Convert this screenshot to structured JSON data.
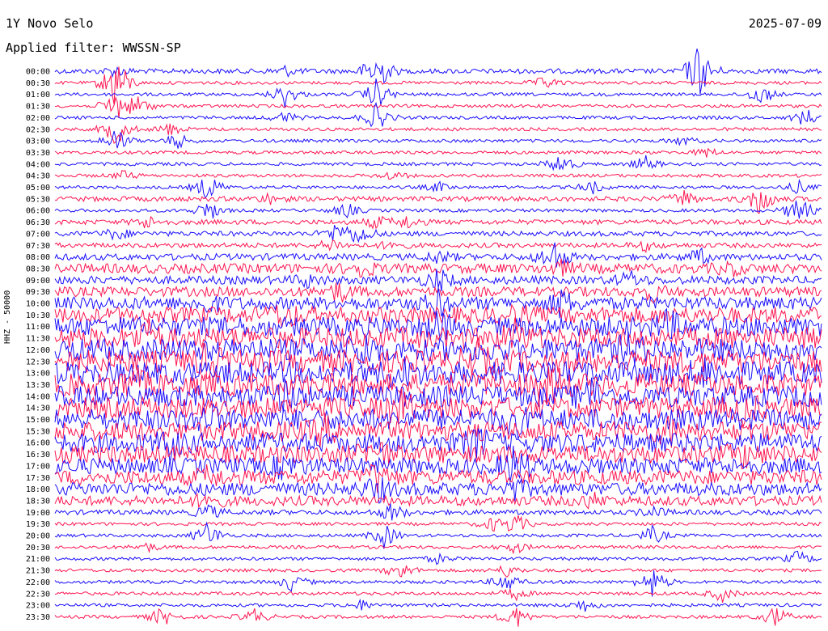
{
  "header": {
    "station": "1Y Novo Selo",
    "date": "2025-07-09",
    "filter": "Applied filter: WWSSN-SP"
  },
  "axis": {
    "ylabel": "HHZ - 50000"
  },
  "colors": {
    "even_trace": "#1a0dff",
    "odd_trace": "#ff1450",
    "background": "#ffffff"
  },
  "chart_data": {
    "type": "line",
    "description_kind": "helicorder",
    "xlabel": "",
    "ylabel": "HHZ - 50000",
    "rows": [
      {
        "time": "00:00",
        "noise": 3,
        "events": [
          [
            0.08,
            6
          ],
          [
            0.42,
            30
          ],
          [
            0.3,
            6
          ],
          [
            0.84,
            36
          ]
        ]
      },
      {
        "time": "00:30",
        "noise": 2,
        "events": [
          [
            0.64,
            8
          ],
          [
            0.08,
            40
          ]
        ]
      },
      {
        "time": "01:00",
        "noise": 2,
        "events": [
          [
            0.3,
            16
          ],
          [
            0.42,
            20
          ],
          [
            0.92,
            14
          ]
        ]
      },
      {
        "time": "01:30",
        "noise": 2,
        "events": [
          [
            0.11,
            12
          ],
          [
            0.08,
            20
          ]
        ]
      },
      {
        "time": "02:00",
        "noise": 2,
        "events": [
          [
            0.3,
            8
          ],
          [
            0.42,
            18
          ],
          [
            0.98,
            12
          ]
        ]
      },
      {
        "time": "02:30",
        "noise": 2,
        "events": [
          [
            0.08,
            22
          ],
          [
            0.15,
            8
          ]
        ]
      },
      {
        "time": "03:00",
        "noise": 2,
        "events": [
          [
            0.08,
            16
          ],
          [
            0.16,
            10
          ],
          [
            0.82,
            6
          ]
        ]
      },
      {
        "time": "03:30",
        "noise": 2,
        "events": [
          [
            0.85,
            6
          ]
        ]
      },
      {
        "time": "04:00",
        "noise": 2,
        "events": [
          [
            0.77,
            10
          ],
          [
            0.66,
            14
          ]
        ]
      },
      {
        "time": "04:30",
        "noise": 2,
        "events": [
          [
            0.09,
            6
          ],
          [
            0.44,
            6
          ]
        ]
      },
      {
        "time": "05:00",
        "noise": 2,
        "events": [
          [
            0.2,
            18
          ],
          [
            0.5,
            6
          ],
          [
            0.7,
            8
          ],
          [
            0.97,
            8
          ]
        ]
      },
      {
        "time": "05:30",
        "noise": 3,
        "events": [
          [
            0.28,
            6
          ],
          [
            0.92,
            22
          ],
          [
            0.82,
            10
          ]
        ]
      },
      {
        "time": "06:00",
        "noise": 2,
        "events": [
          [
            0.2,
            14
          ],
          [
            0.38,
            10
          ],
          [
            0.97,
            20
          ]
        ]
      },
      {
        "time": "06:30",
        "noise": 3,
        "events": [
          [
            0.12,
            8
          ],
          [
            0.42,
            8
          ],
          [
            0.46,
            8
          ]
        ]
      },
      {
        "time": "07:00",
        "noise": 3,
        "events": [
          [
            0.37,
            16
          ],
          [
            0.4,
            12
          ],
          [
            0.08,
            8
          ]
        ]
      },
      {
        "time": "07:30",
        "noise": 3,
        "events": [
          [
            0.36,
            8
          ],
          [
            0.44,
            6
          ],
          [
            0.77,
            6
          ]
        ]
      },
      {
        "time": "08:00",
        "noise": 4,
        "events": [
          [
            0.5,
            8
          ],
          [
            0.84,
            10
          ],
          [
            0.65,
            22
          ]
        ]
      },
      {
        "time": "08:30",
        "noise": 6,
        "events": [
          [
            0.4,
            10
          ],
          [
            0.66,
            8
          ],
          [
            0.88,
            8
          ]
        ]
      },
      {
        "time": "09:00",
        "noise": 5,
        "events": [
          [
            0.5,
            14
          ],
          [
            0.75,
            10
          ],
          [
            0.33,
            8
          ]
        ]
      },
      {
        "time": "09:30",
        "noise": 6,
        "events": [
          [
            0.37,
            12
          ],
          [
            0.78,
            10
          ]
        ]
      },
      {
        "time": "10:00",
        "noise": 8,
        "events": [
          [
            0.5,
            14
          ],
          [
            0.66,
            16
          ],
          [
            0.2,
            10
          ]
        ]
      },
      {
        "time": "10:30",
        "noise": 10,
        "events": [
          [
            0.3,
            14
          ],
          [
            0.6,
            12
          ]
        ]
      },
      {
        "time": "11:00",
        "noise": 12,
        "events": [
          [
            0.5,
            14
          ],
          [
            0.8,
            14
          ]
        ]
      },
      {
        "time": "11:30",
        "noise": 13,
        "events": [
          [
            0.12,
            16
          ],
          [
            0.6,
            14
          ]
        ]
      },
      {
        "time": "12:00",
        "noise": 14,
        "events": [
          [
            0.4,
            18
          ],
          [
            0.75,
            14
          ]
        ]
      },
      {
        "time": "12:30",
        "noise": 14,
        "events": [
          [
            0.2,
            16
          ],
          [
            0.55,
            18
          ]
        ]
      },
      {
        "time": "13:00",
        "noise": 14,
        "events": [
          [
            0.45,
            16
          ],
          [
            0.85,
            14
          ]
        ]
      },
      {
        "time": "13:30",
        "noise": 14,
        "events": [
          [
            0.1,
            16
          ],
          [
            0.65,
            18
          ]
        ]
      },
      {
        "time": "14:00",
        "noise": 13,
        "events": [
          [
            0.3,
            14
          ],
          [
            0.7,
            16
          ]
        ]
      },
      {
        "time": "14:30",
        "noise": 13,
        "events": [
          [
            0.45,
            18
          ],
          [
            0.9,
            14
          ]
        ]
      },
      {
        "time": "15:00",
        "noise": 13,
        "events": [
          [
            0.2,
            14
          ],
          [
            0.6,
            16
          ]
        ]
      },
      {
        "time": "15:30",
        "noise": 12,
        "events": [
          [
            0.35,
            14
          ],
          [
            0.8,
            14
          ]
        ]
      },
      {
        "time": "16:00",
        "noise": 12,
        "events": [
          [
            0.15,
            14
          ],
          [
            0.55,
            16
          ]
        ]
      },
      {
        "time": "16:30",
        "noise": 11,
        "events": [
          [
            0.42,
            16
          ],
          [
            0.9,
            12
          ]
        ]
      },
      {
        "time": "17:00",
        "noise": 10,
        "events": [
          [
            0.3,
            14
          ],
          [
            0.6,
            22
          ]
        ]
      },
      {
        "time": "17:30",
        "noise": 9,
        "events": [
          [
            0.42,
            16
          ],
          [
            0.2,
            10
          ]
        ]
      },
      {
        "time": "18:00",
        "noise": 8,
        "events": [
          [
            0.42,
            14
          ],
          [
            0.6,
            10
          ]
        ]
      },
      {
        "time": "18:30",
        "noise": 6,
        "events": [
          [
            0.2,
            10
          ],
          [
            0.7,
            8
          ]
        ]
      },
      {
        "time": "19:00",
        "noise": 3,
        "events": [
          [
            0.2,
            10
          ],
          [
            0.44,
            12
          ],
          [
            0.78,
            8
          ]
        ]
      },
      {
        "time": "19:30",
        "noise": 2,
        "events": [
          [
            0.57,
            8
          ],
          [
            0.6,
            14
          ]
        ]
      },
      {
        "time": "20:00",
        "noise": 2,
        "events": [
          [
            0.2,
            18
          ],
          [
            0.43,
            16
          ],
          [
            0.78,
            12
          ]
        ]
      },
      {
        "time": "20:30",
        "noise": 2,
        "events": [
          [
            0.12,
            6
          ],
          [
            0.6,
            8
          ]
        ]
      },
      {
        "time": "21:00",
        "noise": 2,
        "events": [
          [
            0.97,
            10
          ],
          [
            0.5,
            6
          ]
        ]
      },
      {
        "time": "21:30",
        "noise": 2,
        "events": [
          [
            0.45,
            12
          ],
          [
            0.59,
            8
          ]
        ]
      },
      {
        "time": "22:00",
        "noise": 2,
        "events": [
          [
            0.31,
            12
          ],
          [
            0.59,
            14
          ],
          [
            0.78,
            20
          ]
        ]
      },
      {
        "time": "22:30",
        "noise": 2,
        "events": [
          [
            0.87,
            10
          ],
          [
            0.6,
            8
          ]
        ]
      },
      {
        "time": "23:00",
        "noise": 2,
        "events": [
          [
            0.69,
            8
          ],
          [
            0.4,
            6
          ]
        ]
      },
      {
        "time": "23:30",
        "noise": 2,
        "events": [
          [
            0.14,
            12
          ],
          [
            0.26,
            10
          ],
          [
            0.6,
            16
          ],
          [
            0.94,
            14
          ]
        ]
      }
    ]
  }
}
